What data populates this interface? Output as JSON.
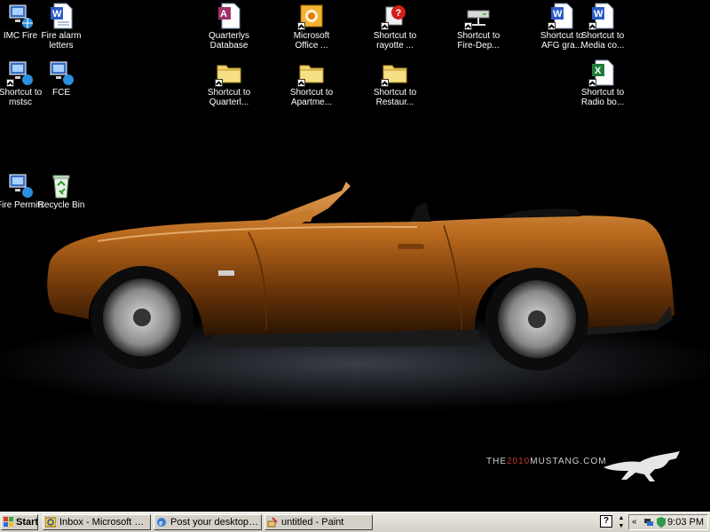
{
  "desktop": {
    "icons": [
      {
        "id": "imc-fire",
        "label": "IMC Fire",
        "type": "network"
      },
      {
        "id": "fire-alarm-letters",
        "label": "Fire alarm\nletters",
        "type": "word"
      },
      {
        "id": "shortcut-to-mstsc",
        "label": "Shortcut to\nmstsc",
        "type": "network"
      },
      {
        "id": "fce",
        "label": "FCE",
        "type": "network"
      },
      {
        "id": "fire-permits",
        "label": "Fire Permits",
        "type": "network"
      },
      {
        "id": "recycle-bin",
        "label": "Recycle Bin",
        "type": "recycle"
      },
      {
        "id": "quarterlys-database",
        "label": "Quarterlys\nDatabase",
        "type": "access"
      },
      {
        "id": "shortcut-to-quarterl",
        "label": "Shortcut to\nQuarterl...",
        "type": "folder"
      },
      {
        "id": "microsoft-office",
        "label": "Microsoft\nOffice ...",
        "type": "office"
      },
      {
        "id": "shortcut-to-apartme",
        "label": "Shortcut to\nApartme...",
        "type": "folder"
      },
      {
        "id": "shortcut-to-rayotte",
        "label": "Shortcut to\nrayotte ...",
        "type": "help"
      },
      {
        "id": "shortcut-to-restaur",
        "label": "Shortcut to\nRestaur...",
        "type": "folder"
      },
      {
        "id": "shortcut-to-fire-dep",
        "label": "Shortcut to\nFire-Dep...",
        "type": "drive"
      },
      {
        "id": "shortcut-to-afg-gra",
        "label": "Shortcut to\nAFG gra...",
        "type": "word"
      },
      {
        "id": "shortcut-to-media-co",
        "label": "Shortcut to\nMedia co...",
        "type": "word"
      },
      {
        "id": "shortcut-to-radio-bo",
        "label": "Shortcut to\nRadio bo...",
        "type": "excel"
      }
    ]
  },
  "wallpaper": {
    "brand_prefix": "THE",
    "brand_year": "2010",
    "brand_suffix": "MUSTANG.COM",
    "car_color": "#b8681c"
  },
  "taskbar": {
    "start_label": "Start",
    "tasks": [
      {
        "label": "Inbox - Microsoft Outlook",
        "icon": "outlook-icon"
      },
      {
        "label": "Post your desktop pictur...",
        "icon": "ie-icon"
      },
      {
        "label": "untitled - Paint",
        "icon": "paint-icon"
      }
    ],
    "help_glyph": "?",
    "clock": "9:03 PM"
  }
}
